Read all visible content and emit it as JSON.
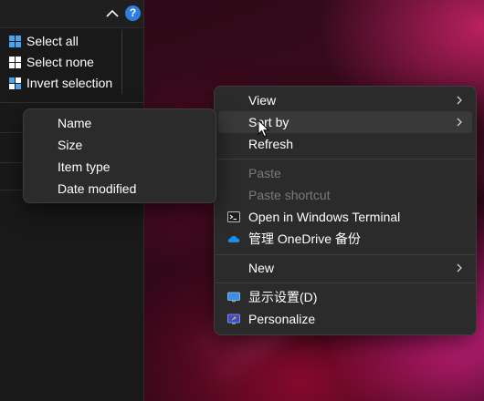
{
  "explorer": {
    "help_glyph": "?",
    "selection_menu": [
      {
        "label": "Select all",
        "icon": "select-all-icon"
      },
      {
        "label": "Select none",
        "icon": "select-none-icon"
      },
      {
        "label": "Invert selection",
        "icon": "invert-selection-icon"
      }
    ]
  },
  "context_menu": {
    "items": [
      {
        "label": "View",
        "submenu": true
      },
      {
        "label": "Sort by",
        "submenu": true,
        "highlighted": true
      },
      {
        "label": "Refresh"
      },
      {
        "label": "Paste",
        "disabled": true
      },
      {
        "label": "Paste shortcut",
        "disabled": true
      },
      {
        "label": "Open in Windows Terminal",
        "icon": "terminal-icon"
      },
      {
        "label": "管理 OneDrive 备份",
        "icon": "onedrive-cloud-icon"
      },
      {
        "label": "New",
        "submenu": true
      },
      {
        "label": "显示设置(D)",
        "icon": "display-settings-icon"
      },
      {
        "label": "Personalize",
        "icon": "personalize-icon"
      }
    ]
  },
  "sort_submenu": {
    "items": [
      "Name",
      "Size",
      "Item type",
      "Date modified"
    ]
  },
  "colors": {
    "menu_bg": "#2b2b2b",
    "disabled_text": "#7a7a7a",
    "accent_blue": "#2f7de0",
    "onedrive_blue": "#1a8ee8"
  }
}
